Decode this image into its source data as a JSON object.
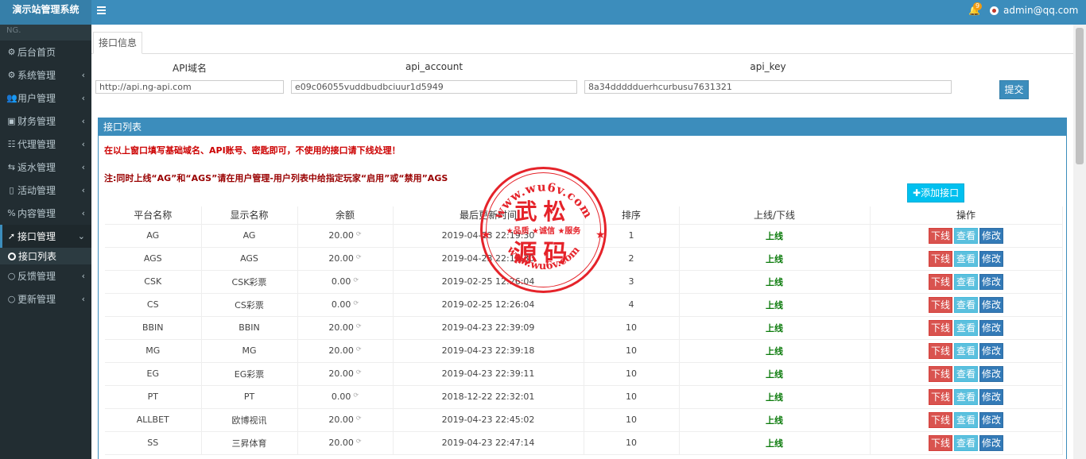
{
  "app": {
    "title": "演示站管理系统"
  },
  "sidebar": {
    "search": "NG.",
    "items": [
      {
        "label": "后台首页",
        "icon": "dashboard-icon",
        "glyph": "⚙"
      },
      {
        "label": "系统管理",
        "icon": "gear-icon",
        "glyph": "⚙"
      },
      {
        "label": "用户管理",
        "icon": "users-icon",
        "glyph": "👥"
      },
      {
        "label": "财务管理",
        "icon": "money-icon",
        "glyph": "▣"
      },
      {
        "label": "代理管理",
        "icon": "list-icon",
        "glyph": "☷"
      },
      {
        "label": "返水管理",
        "icon": "share-icon",
        "glyph": "⇆"
      },
      {
        "label": "活动管理",
        "icon": "book-icon",
        "glyph": "▯"
      },
      {
        "label": "内容管理",
        "icon": "code-icon",
        "glyph": "%"
      },
      {
        "label": "接口管理",
        "icon": "send-icon",
        "glyph": "➚"
      },
      {
        "label": "反馈管理",
        "icon": "comment-icon",
        "glyph": "○"
      },
      {
        "label": "更新管理",
        "icon": "comment-icon",
        "glyph": "○"
      }
    ],
    "sub_item": "接口列表"
  },
  "topbar": {
    "badge": "9",
    "user": "admin@qq.com"
  },
  "tab": {
    "label": "接口信息"
  },
  "form": {
    "domain_label": "API域名",
    "account_label": "api_account",
    "key_label": "api_key",
    "domain_value": "http://api.ng-api.com",
    "account_value": "e09c06055vuddbudbciuur1d5949",
    "key_value": "8a34ddddduerhcurbusu7631321",
    "submit": "提交"
  },
  "panel": {
    "title": "接口列表",
    "note1": "在以上窗口填写基础域名、API账号、密匙即可，不使用的接口请下线处理！",
    "note2": "注:同时上线“AG”和“AGS”请在用户管理-用户列表中给指定玩家“启用”或“禁用”AGS",
    "add_button": "添加接口"
  },
  "table": {
    "columns": [
      "平台名称",
      "显示名称",
      "余额",
      "最后更新时间",
      "排序",
      "上线/下线",
      "操作"
    ],
    "actions": {
      "off": "下线",
      "view": "查看",
      "edit": "修改"
    },
    "rows": [
      {
        "platform": "AG",
        "display": "AG",
        "balance": "20.00",
        "updated": "2019-04-23 22:19:30",
        "order": "1",
        "status": "上线"
      },
      {
        "platform": "AGS",
        "display": "AGS",
        "balance": "20.00",
        "updated": "2019-04-23 22:19:30",
        "order": "2",
        "status": "上线"
      },
      {
        "platform": "CSK",
        "display": "CSK彩票",
        "balance": "0.00",
        "updated": "2019-02-25 12:26:04",
        "order": "3",
        "status": "上线"
      },
      {
        "platform": "CS",
        "display": "CS彩票",
        "balance": "0.00",
        "updated": "2019-02-25 12:26:04",
        "order": "4",
        "status": "上线"
      },
      {
        "platform": "BBIN",
        "display": "BBIN",
        "balance": "20.00",
        "updated": "2019-04-23 22:39:09",
        "order": "10",
        "status": "上线"
      },
      {
        "platform": "MG",
        "display": "MG",
        "balance": "20.00",
        "updated": "2019-04-23 22:39:18",
        "order": "10",
        "status": "上线"
      },
      {
        "platform": "EG",
        "display": "EG彩票",
        "balance": "20.00",
        "updated": "2019-04-23 22:39:11",
        "order": "10",
        "status": "上线"
      },
      {
        "platform": "PT",
        "display": "PT",
        "balance": "0.00",
        "updated": "2018-12-22 22:32:01",
        "order": "10",
        "status": "上线"
      },
      {
        "platform": "ALLBET",
        "display": "欧博视讯",
        "balance": "20.00",
        "updated": "2019-04-23 22:45:02",
        "order": "10",
        "status": "上线"
      },
      {
        "platform": "SS",
        "display": "三昇体育",
        "balance": "20.00",
        "updated": "2019-04-23 22:47:14",
        "order": "10",
        "status": "上线"
      }
    ]
  },
  "watermark": {
    "url": "www.wu6v.com",
    "line1": "武松",
    "line2": "源码",
    "slogan": "★品质 ★诚信 ★服务"
  },
  "colors": {
    "primary": "#3c8dbc",
    "sidebar": "#222d32",
    "danger": "#d9534f",
    "info": "#5bc0de",
    "online": "#0a7a0a",
    "stamp": "#e5232a"
  }
}
